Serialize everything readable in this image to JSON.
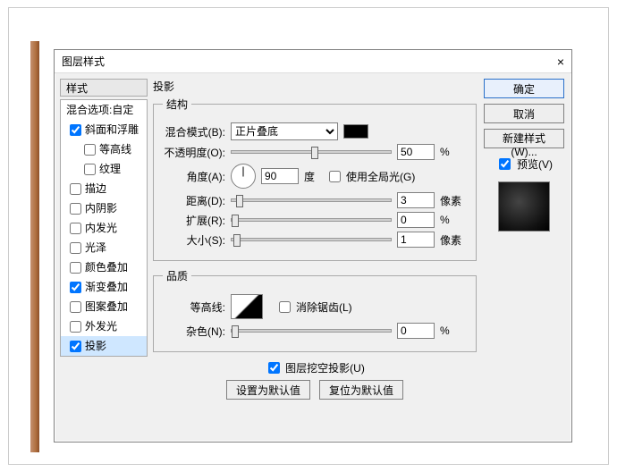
{
  "dialog": {
    "title": "图层样式",
    "close": "×"
  },
  "left": {
    "header": "样式",
    "blend_options": "混合选项:自定",
    "items": [
      {
        "label": "斜面和浮雕",
        "checked": true
      },
      {
        "label": "等高线",
        "checked": false,
        "indent": true
      },
      {
        "label": "纹理",
        "checked": false,
        "indent": true
      },
      {
        "label": "描边",
        "checked": false
      },
      {
        "label": "内阴影",
        "checked": false
      },
      {
        "label": "内发光",
        "checked": false
      },
      {
        "label": "光泽",
        "checked": false
      },
      {
        "label": "颜色叠加",
        "checked": false
      },
      {
        "label": "渐变叠加",
        "checked": true
      },
      {
        "label": "图案叠加",
        "checked": false
      },
      {
        "label": "外发光",
        "checked": false
      },
      {
        "label": "投影",
        "checked": true,
        "selected": true
      }
    ]
  },
  "panel": {
    "title": "投影",
    "structure": {
      "legend": "结构",
      "blend_label": "混合模式(B):",
      "blend_value": "正片叠底",
      "opacity_label": "不透明度(O):",
      "opacity_value": "50",
      "opacity_unit": "%",
      "angle_label": "角度(A):",
      "angle_value": "90",
      "angle_unit": "度",
      "global_light": "使用全局光(G)",
      "distance_label": "距离(D):",
      "distance_value": "3",
      "distance_unit": "像素",
      "spread_label": "扩展(R):",
      "spread_value": "0",
      "spread_unit": "%",
      "size_label": "大小(S):",
      "size_value": "1",
      "size_unit": "像素"
    },
    "quality": {
      "legend": "品质",
      "contour_label": "等高线:",
      "antialias": "消除锯齿(L)",
      "noise_label": "杂色(N):",
      "noise_value": "0",
      "noise_unit": "%"
    },
    "knockout": "图层挖空投影(U)",
    "set_default": "设置为默认值",
    "reset_default": "复位为默认值"
  },
  "right": {
    "ok": "确定",
    "cancel": "取消",
    "new_style": "新建样式(W)...",
    "preview": "预览(V)"
  }
}
